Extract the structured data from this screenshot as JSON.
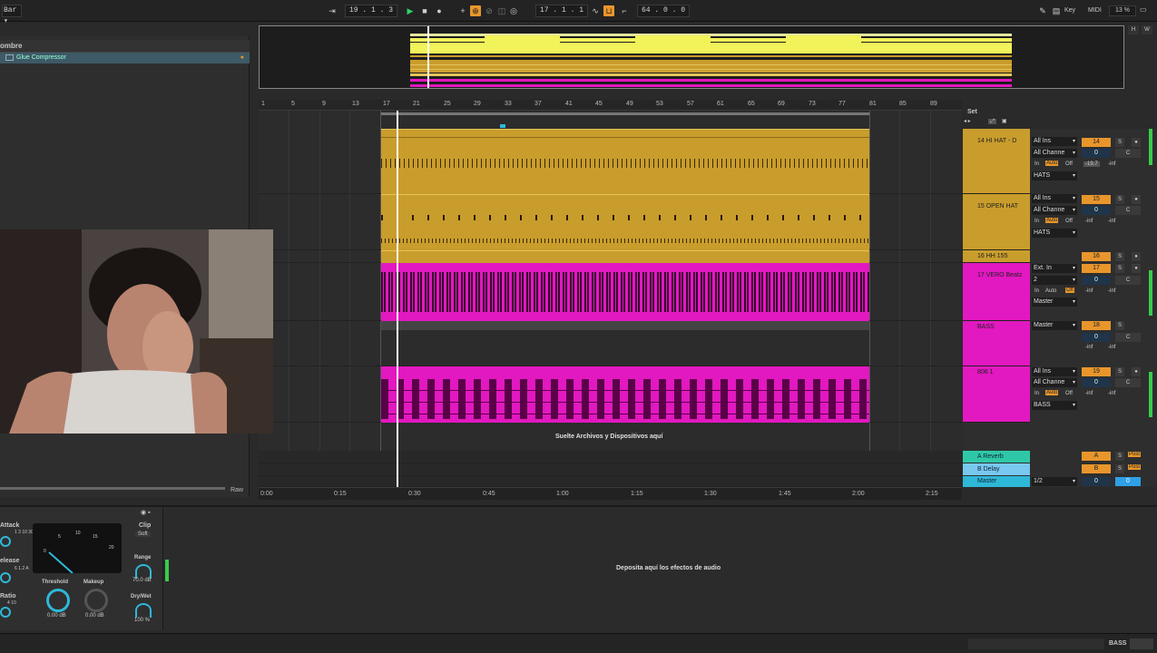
{
  "top_bar": {
    "left_label": "Bar",
    "position": "19 .  1 .  3",
    "end_position": "17 .  1 .  1",
    "loop_length": "64 .  0 .  0",
    "key_label": "Key",
    "midi_label": "MIDI",
    "cpu": "13 %"
  },
  "overview_buttons": [
    "H",
    "W"
  ],
  "browser": {
    "header": "ombre",
    "item": "Glue Compressor",
    "raw_label": "Raw"
  },
  "ruler_bars": [
    "1",
    "5",
    "9",
    "13",
    "17",
    "21",
    "25",
    "29",
    "33",
    "37",
    "41",
    "45",
    "49",
    "53",
    "57",
    "61",
    "65",
    "69",
    "73",
    "77",
    "81",
    "85",
    "89"
  ],
  "time_labels": [
    "0:00",
    "0:15",
    "0:30",
    "0:45",
    "1:00",
    "1:15",
    "1:30",
    "1:45",
    "2:00",
    "2:15"
  ],
  "set_label": "Set",
  "drop_files_hint": "Suelte Archivos y Dispositivos aquí",
  "drop_effects_hint": "Deposita aquí los efectos de audio",
  "tracks": [
    {
      "name": "14 HI HAT - D",
      "color": "#c99d2c",
      "input": "All Ins",
      "channel": "All Channe",
      "routing": "HATS",
      "monitor": [
        "In",
        "Auto",
        "Off"
      ],
      "number": "14",
      "vol": "0",
      "pan": "C",
      "vol_db": "-19.7",
      "peak": "-inf"
    },
    {
      "name": "15 OPEN HAT",
      "color": "#c99d2c",
      "input": "All Ins",
      "channel": "All Channe",
      "routing": "HATS",
      "monitor": [
        "In",
        "Auto",
        "Off"
      ],
      "number": "15",
      "vol": "0",
      "pan": "C",
      "vol_db": "-inf",
      "peak": "-inf"
    },
    {
      "name": "16 HH 155",
      "color": "#c99d2c",
      "number": "16"
    },
    {
      "name": "17 VERO Beatz",
      "color": "#e218c0",
      "input": "Ext. In",
      "channel": "2",
      "routing": "Master",
      "monitor": [
        "In",
        "Auto",
        "Off"
      ],
      "number": "17",
      "vol": "0",
      "pan": "C",
      "vol_db": "-inf",
      "peak": "-inf"
    },
    {
      "name": "BASS",
      "color": "#e218c0",
      "input": "Master",
      "number": "18",
      "vol": "0",
      "pan": "C",
      "vol_db": "-inf",
      "peak": "-inf"
    },
    {
      "name": "808 1",
      "color": "#e218c0",
      "input": "All Ins",
      "channel": "All Channe",
      "routing": "BASS",
      "monitor": [
        "In",
        "Auto",
        "Off"
      ],
      "number": "19",
      "vol": "0",
      "pan": "C",
      "vol_db": "-inf",
      "peak": "-inf"
    }
  ],
  "returns": [
    {
      "name": "A Reverb",
      "color": "#2ec8a8",
      "letter": "A",
      "post": "Post"
    },
    {
      "name": "B Delay",
      "color": "#78c8f0",
      "letter": "B",
      "post": "Post"
    },
    {
      "name": "Master",
      "color": "#2eb8d8",
      "ratio": "1/2",
      "vol": "0",
      "pan": "0"
    }
  ],
  "device": {
    "attack_label": "Attack",
    "release_label": "elease",
    "ratio_label": "Ratio",
    "attack_vals": [
      "1",
      "3",
      "10",
      "30"
    ],
    "release_vals": [
      "6",
      "1.2",
      "A"
    ],
    "ratio_vals": [
      "4",
      "10"
    ],
    "clip_label": "Clip",
    "soft_label": "Soft",
    "meter_ticks": [
      "0",
      "5",
      "10",
      "15",
      "20"
    ],
    "threshold_label": "Threshold",
    "threshold_val": "0.00 dB",
    "makeup_label": "Makeup",
    "makeup_val": "0.00 dB",
    "range_label": "Range",
    "range_val": "70.0 dB",
    "drywet_label": "Dry/Wet",
    "drywet_val": "100 %"
  },
  "bottom_track_label": "BASS"
}
